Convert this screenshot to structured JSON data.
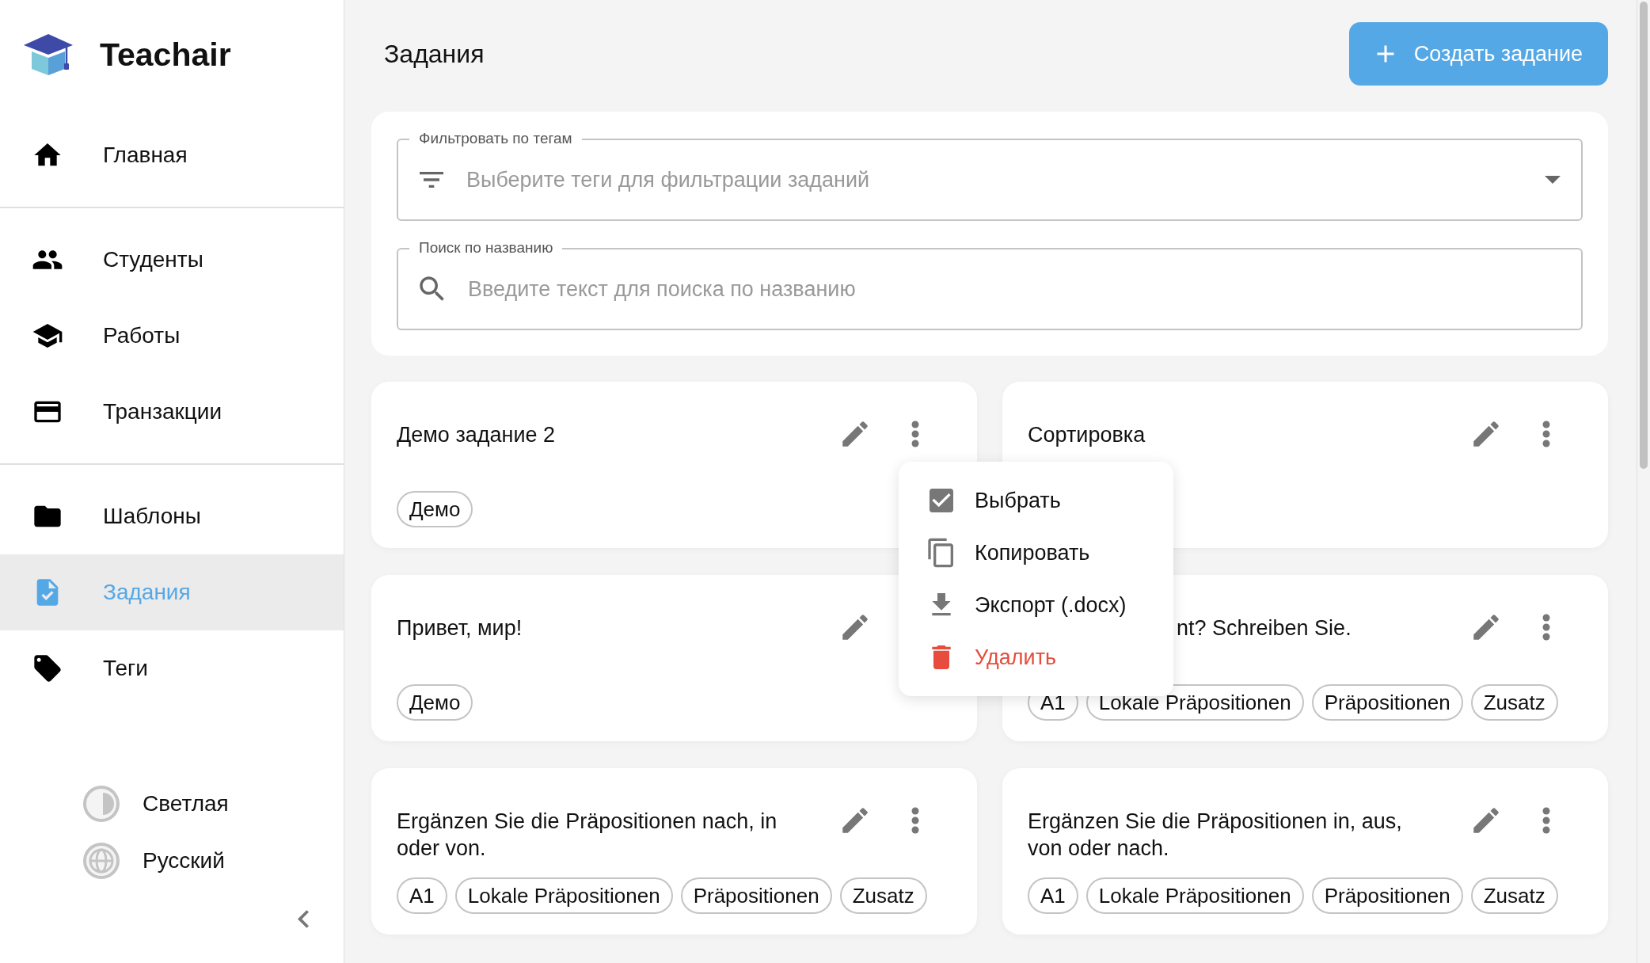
{
  "app": {
    "name": "Teachair"
  },
  "sidebar": {
    "groups": [
      [
        {
          "label": "Главная",
          "selected": false
        }
      ],
      [
        {
          "label": "Студенты",
          "selected": false
        },
        {
          "label": "Работы",
          "selected": false
        },
        {
          "label": "Транзакции",
          "selected": false
        }
      ],
      [
        {
          "label": "Шаблоны",
          "selected": false
        },
        {
          "label": "Задания",
          "selected": true
        },
        {
          "label": "Теги",
          "selected": false
        }
      ]
    ],
    "settings": [
      {
        "label": "Светлая"
      },
      {
        "label": "Русский"
      }
    ]
  },
  "page": {
    "title": "Задания",
    "create_button": "Создать задание"
  },
  "filters": {
    "tag_filter": {
      "label": "Фильтровать по тегам",
      "placeholder": "Выберите теги для фильтрации заданий"
    },
    "search": {
      "label": "Поиск по названию",
      "placeholder": "Введите текст для поиска по названию"
    }
  },
  "cards": [
    {
      "title": "Демо задание 2",
      "tags": [
        "Демо"
      ]
    },
    {
      "title": "Сортировка"
    },
    {
      "title": "Привет, мир!",
      "tags": [
        "Демо"
      ]
    },
    {
      "title": "nt? Schreiben Sie.",
      "tags": [
        "A1",
        "Lokale Präpositionen",
        "Präpositionen",
        "Zusatz"
      ],
      "covered": true
    },
    {
      "title": "Ergänzen Sie die Präpositionen nach, in oder von.",
      "tags": [
        "A1",
        "Lokale Präpositionen",
        "Präpositionen",
        "Zusatz"
      ]
    },
    {
      "title": "Ergänzen Sie die Präpositionen in, aus, von oder nach.",
      "tags": [
        "A1",
        "Lokale Präpositionen",
        "Präpositionen",
        "Zusatz"
      ]
    }
  ],
  "menu": {
    "items": [
      {
        "label": "Выбрать",
        "kind": "normal"
      },
      {
        "label": "Копировать",
        "kind": "normal"
      },
      {
        "label": "Экспорт (.docx)",
        "kind": "normal"
      },
      {
        "label": "Удалить",
        "kind": "danger"
      }
    ]
  }
}
